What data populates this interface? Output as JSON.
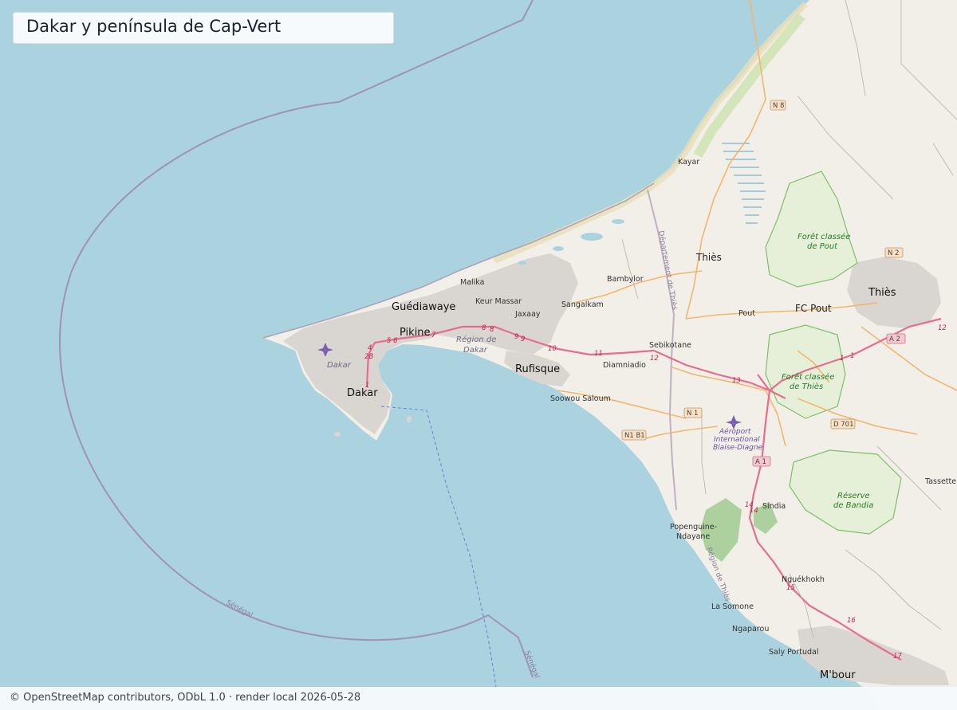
{
  "title": "Dakar y península de Cap-Vert",
  "attribution": "© OpenStreetMap contributors, ODbL 1.0 · render local 2026-05-28",
  "colors": {
    "sea": "#aad3df",
    "land": "#f2efe9",
    "urban": "#d9d5d1",
    "forest": "#add19e",
    "boundary": "#9e87a8",
    "motorway": "#e66e8c",
    "primary": "#f4b56c",
    "wetland": "#6fb3d6"
  },
  "labels": {
    "dakar": "Dakar",
    "dakar_region": "Dakar",
    "guediawaye": "Guédiawaye",
    "pikine": "Pikine",
    "malika": "Malika",
    "keur_massar": "Keur Massar",
    "jaxaay": "Jaxaay",
    "sangalkam": "Sangalkam",
    "bambylor": "Bambylor",
    "rufisque": "Rufisque",
    "region_dakar_1": "Région de",
    "region_dakar_2": "Dakar",
    "kayar": "Kayar",
    "thies_dept": "Thiès",
    "thies_city": "Thiès",
    "departement": "Département de Thiès",
    "sebikotane": "Sebikotane",
    "diamniadio": "Diamniadio",
    "soowou_saloum": "Soowou Saloum",
    "pout": "Pout",
    "fc_pout": "FC Pout",
    "foret_pout_1": "Forêt classée",
    "foret_pout_2": "de Pout",
    "foret_thies_1": "Forêt classée",
    "foret_thies_2": "de Thiès",
    "reserve_1": "Réserve",
    "reserve_2": "de Bandia",
    "airport_1": "Aéroport",
    "airport_2": "International",
    "airport_3": "Blaise-Diagne",
    "sindia": "Sindia",
    "popenguine_1": "Popenguine-",
    "popenguine_2": "Ndayane",
    "region_thies": "Région de Thiès",
    "nguekhokh": "Nguékhokh",
    "la_somone": "La Somone",
    "ngaparou": "Ngaparou",
    "saly": "Saly Portudal",
    "mbour": "M'bour",
    "tassette": "Tassette",
    "senegal_1": "Sénégal",
    "senegal_2": "Sénégal"
  },
  "shields": {
    "n8": "N 8",
    "n2": "N 2",
    "a2": "A 2",
    "n1": "N 1",
    "n1b1": "N1 B1",
    "a1": "A 1",
    "d701": "D 701"
  },
  "road_numbers": [
    "4",
    "2B",
    "1",
    "5",
    "6",
    "7",
    "8",
    "8",
    "9",
    "9",
    "10",
    "11",
    "12",
    "13",
    "1",
    "1",
    "12",
    "14",
    "14",
    "15",
    "16",
    "17"
  ]
}
